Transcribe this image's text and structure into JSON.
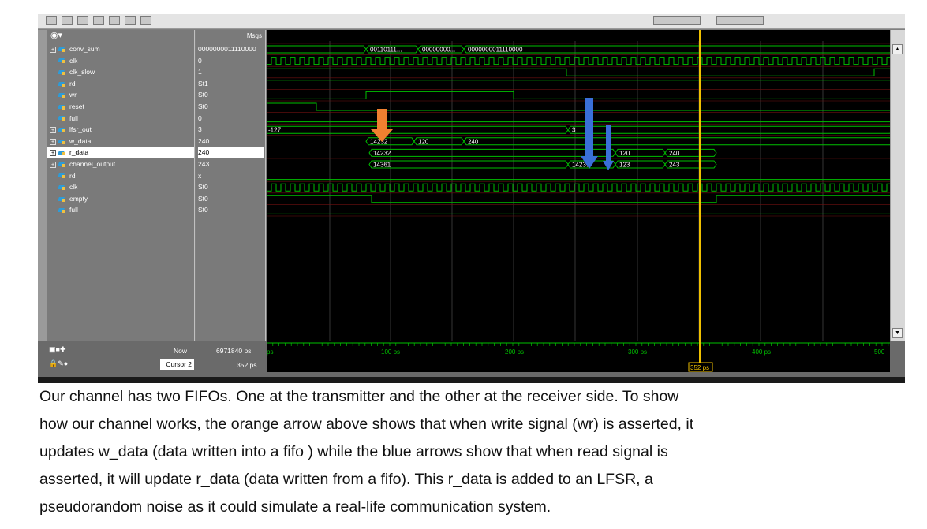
{
  "wave": {
    "names_header": "",
    "values_header": "Msgs",
    "signals": [
      {
        "name": "conv_sum",
        "value": "0000000011110000",
        "expand": "+"
      },
      {
        "name": "clk",
        "value": "0",
        "expand": ""
      },
      {
        "name": "clk_slow",
        "value": "1",
        "expand": ""
      },
      {
        "name": "rd",
        "value": "St1",
        "expand": ""
      },
      {
        "name": "wr",
        "value": "St0",
        "expand": ""
      },
      {
        "name": "reset",
        "value": "St0",
        "expand": ""
      },
      {
        "name": "full",
        "value": "0",
        "expand": ""
      },
      {
        "name": "lfsr_out",
        "value": "3",
        "expand": "+"
      },
      {
        "name": "w_data",
        "value": "240",
        "expand": "+"
      },
      {
        "name": "r_data",
        "value": "240",
        "expand": "+"
      },
      {
        "name": "channel_output",
        "value": "243",
        "expand": "+"
      },
      {
        "name": "rd",
        "value": "x",
        "expand": ""
      },
      {
        "name": "clk",
        "value": "St0",
        "expand": ""
      },
      {
        "name": "empty",
        "value": "St0",
        "expand": ""
      },
      {
        "name": "full",
        "value": "St0",
        "expand": ""
      }
    ],
    "bus_labels": {
      "conv_sum": [
        "00110111...",
        "00000000...",
        "0000000011110000"
      ],
      "lfsr_out": [
        "-127",
        "3"
      ],
      "w_data": [
        "14232",
        "120",
        "240"
      ],
      "r_data": [
        "14232",
        "120",
        "240"
      ],
      "channel_output": [
        "14361",
        "14235",
        "123",
        "243"
      ]
    },
    "now_label": "Now",
    "now_value": "6971840 ps",
    "cursor_label": "Cursor 2",
    "cursor_value": "352 ps",
    "cursor_marker": "352 ps",
    "axis_ticks": [
      "ps",
      "100 ps",
      "200 ps",
      "300 ps",
      "400 ps",
      "500"
    ],
    "colors": {
      "wave": "#00c000",
      "bus_text": "#ffffff",
      "cursor": "#f0c000",
      "orange_arrow": "#f08030",
      "blue_arrow": "#3a6fd8"
    }
  },
  "caption": {
    "lines": [
      "Our channel has two FIFOs. One at the transmitter and the other at the receiver side. To show",
      "how our channel works, the orange arrow above shows that when write signal (wr) is asserted, it",
      "updates w_data (data written into a fifo ) while the blue arrows show that when read signal is",
      "asserted, it will update r_data (data written from a fifo). This r_data is added to an LFSR, a",
      "pseudorandom noise as it could simulate a real-life communication system."
    ]
  }
}
